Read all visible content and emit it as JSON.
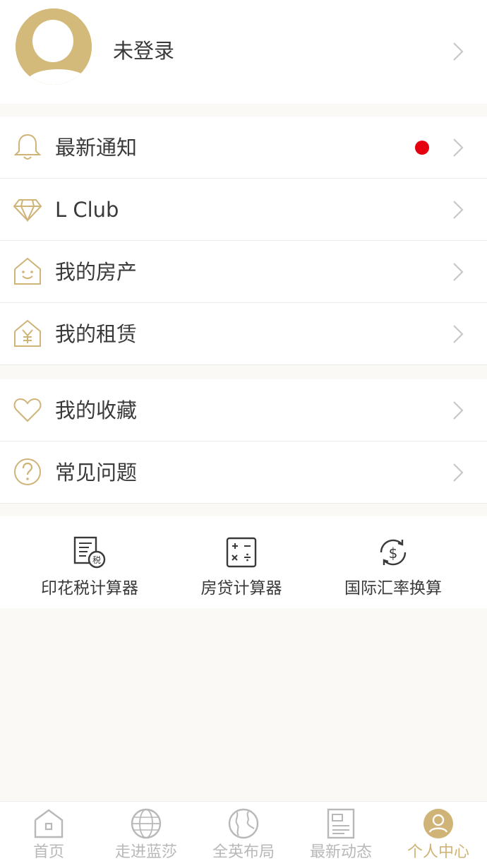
{
  "profile": {
    "login_status": "未登录"
  },
  "menu_group_1": {
    "items": [
      {
        "label": "最新通知",
        "icon": "bell-icon",
        "has_unread_dot": true
      },
      {
        "label": "L Club",
        "icon": "diamond-icon"
      },
      {
        "label": "我的房产",
        "icon": "house-smile-icon"
      },
      {
        "label": "我的租赁",
        "icon": "house-yen-icon"
      }
    ]
  },
  "menu_group_2": {
    "items": [
      {
        "label": "我的收藏",
        "icon": "heart-icon"
      },
      {
        "label": "常见问题",
        "icon": "question-circle-icon"
      }
    ]
  },
  "tools": {
    "items": [
      {
        "label": "印花税计算器",
        "icon": "tax-document-icon"
      },
      {
        "label": "房贷计算器",
        "icon": "calculator-icon"
      },
      {
        "label": "国际汇率换算",
        "icon": "currency-exchange-icon"
      }
    ]
  },
  "tabbar": {
    "items": [
      {
        "label": "首页",
        "icon": "home-icon",
        "active": false
      },
      {
        "label": "走进蓝莎",
        "icon": "brand-globe-icon",
        "active": false
      },
      {
        "label": "全英布局",
        "icon": "globe-icon",
        "active": false
      },
      {
        "label": "最新动态",
        "icon": "news-icon",
        "active": false
      },
      {
        "label": "个人中心",
        "icon": "user-icon",
        "active": true
      }
    ]
  },
  "colors": {
    "accent_gold": "#cfb377",
    "avatar_gold": "#d3b97a",
    "unread_dot": "#e4000f",
    "background": "#faf9f5"
  }
}
